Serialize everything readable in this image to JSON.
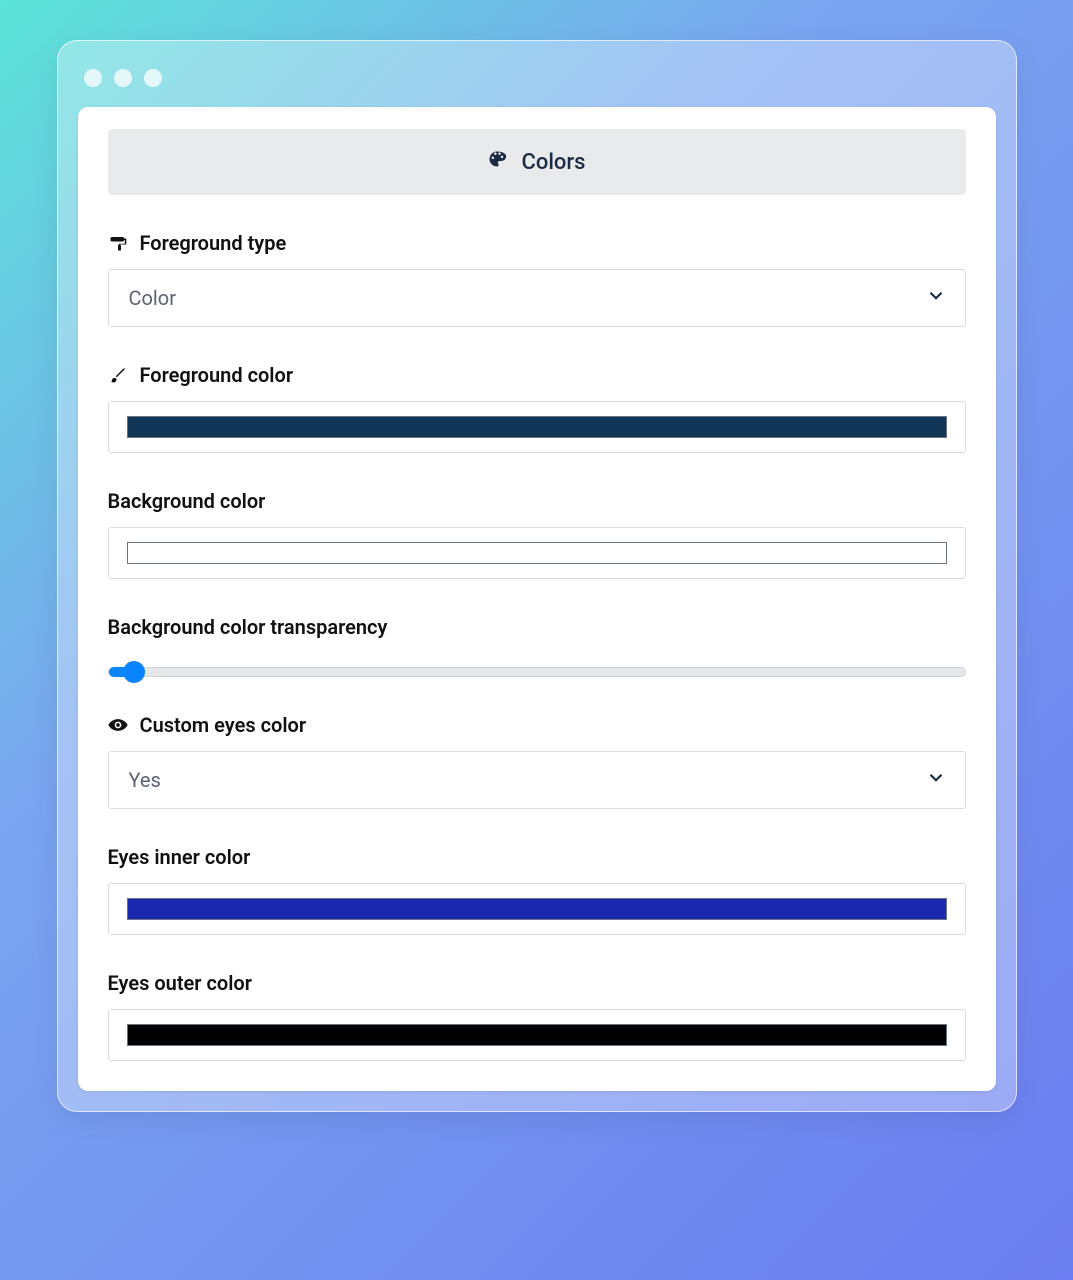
{
  "header": {
    "title": "Colors"
  },
  "fields": {
    "foreground_type": {
      "label": "Foreground type",
      "value": "Color"
    },
    "foreground_color": {
      "label": "Foreground color",
      "value": "#113556"
    },
    "background_color": {
      "label": "Background color",
      "value": "#ffffff"
    },
    "background_transparency": {
      "label": "Background color transparency",
      "value_percent": 3
    },
    "custom_eyes_color": {
      "label": "Custom eyes color",
      "value": "Yes"
    },
    "eyes_inner_color": {
      "label": "Eyes inner color",
      "value": "#1a28b0"
    },
    "eyes_outer_color": {
      "label": "Eyes outer color",
      "value": "#000000"
    }
  },
  "icons": {
    "palette": "palette-icon",
    "roller": "paint-roller-icon",
    "brush": "brush-icon",
    "eye": "eye-icon",
    "chevron": "chevron-down-icon"
  }
}
